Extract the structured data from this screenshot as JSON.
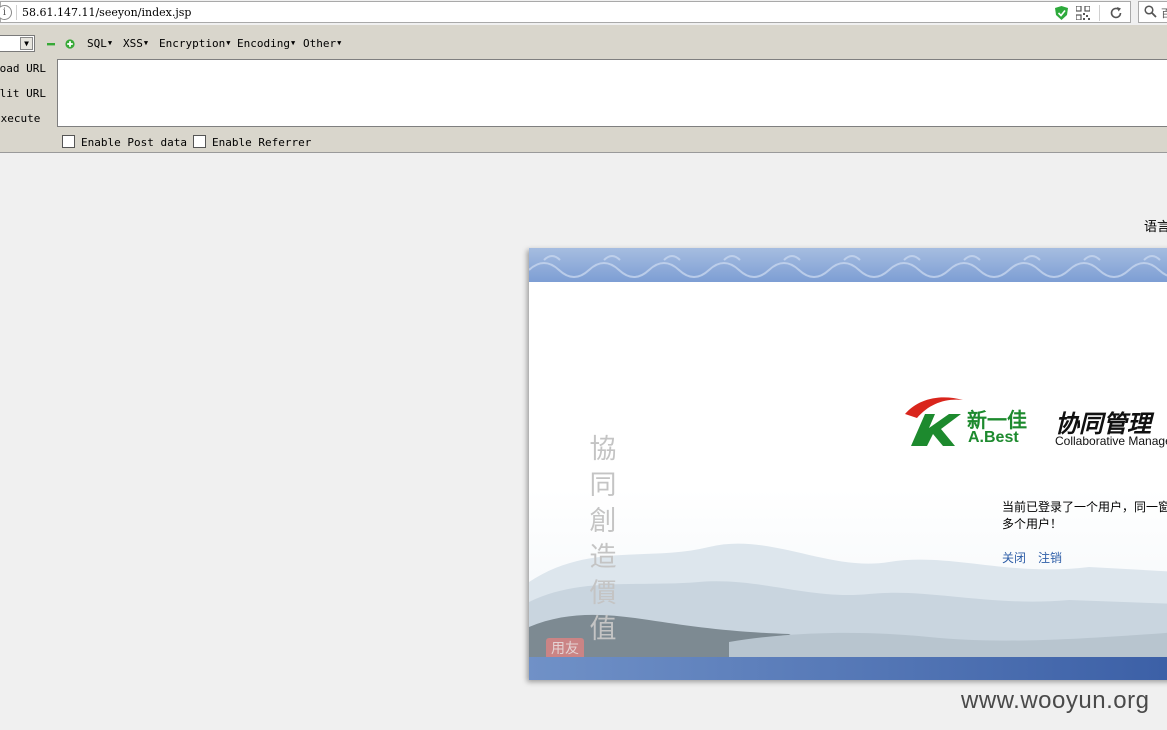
{
  "browser": {
    "url": "58.61.147.11/seeyon/index.jsp",
    "search_placeholder_trunc": "百"
  },
  "hackbar": {
    "menus": [
      "SQL",
      "XSS",
      "Encryption",
      "Encoding",
      "Other"
    ],
    "actions": [
      "Load URL",
      "Split URL",
      "Execute"
    ],
    "checkboxes": [
      "Enable Post data",
      "Enable Referrer"
    ]
  },
  "page": {
    "language_label": "语言",
    "slogan": [
      "協",
      "同",
      "創",
      "造",
      "價",
      "值"
    ],
    "seal_text": "用友软件",
    "brand_cn": "新一佳",
    "brand_en": "A.Best",
    "brand_title": "协同管理",
    "brand_sub": "Collaborative Management",
    "notice_line1": "当前已登录了一个用户，同一窗口中不能登录",
    "notice_line2": "多个用户！",
    "link_close": "关闭",
    "link_logout": "注销"
  },
  "watermark": "www.wooyun.org",
  "colors": {
    "brand_green": "#1d8a2e",
    "brand_red": "#d9251c",
    "link_blue": "#2f5fa8",
    "header_blue": "#7d9ed4"
  }
}
